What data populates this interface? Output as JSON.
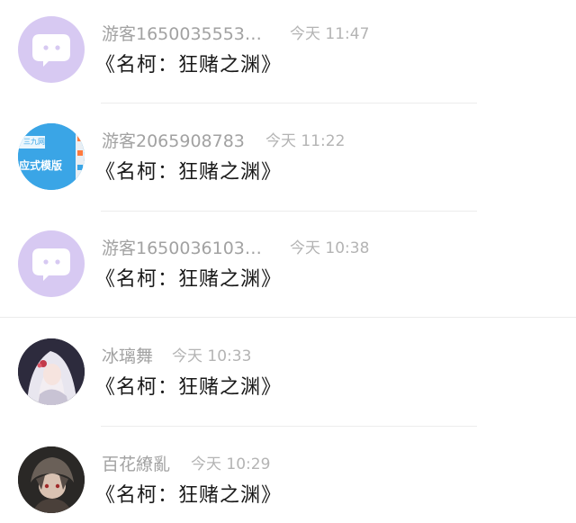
{
  "comments": [
    {
      "user": "游客1650035553…",
      "time": "今天 11:47",
      "message": "《名柯：狂赌之渊》",
      "avatar": "chat-bubble-avatar"
    },
    {
      "user": "游客2065908783",
      "time": "今天 11:22",
      "message": "《名柯：狂赌之渊》",
      "avatar": "app-promo-avatar",
      "avatar_text_top": "三九网",
      "avatar_text_main": "应式模版"
    },
    {
      "user": "游客1650036103…",
      "time": "今天 10:38",
      "message": "《名柯：狂赌之渊》",
      "avatar": "chat-bubble-avatar"
    },
    {
      "user": "冰璃舞",
      "time": "今天 10:33",
      "message": "《名柯：狂赌之渊》",
      "avatar": "anime-girl-avatar"
    },
    {
      "user": "百花繚亂",
      "time": "今天 10:29",
      "message": "《名柯：狂赌之渊》",
      "avatar": "anime-character-avatar"
    }
  ],
  "colors": {
    "bubble_avatar_bg": "#d7c9f2",
    "promo_avatar_bg": "#3aa5e6",
    "username": "#a2a2a2",
    "timestamp": "#b4b4b4",
    "message": "#1a1a1a"
  }
}
